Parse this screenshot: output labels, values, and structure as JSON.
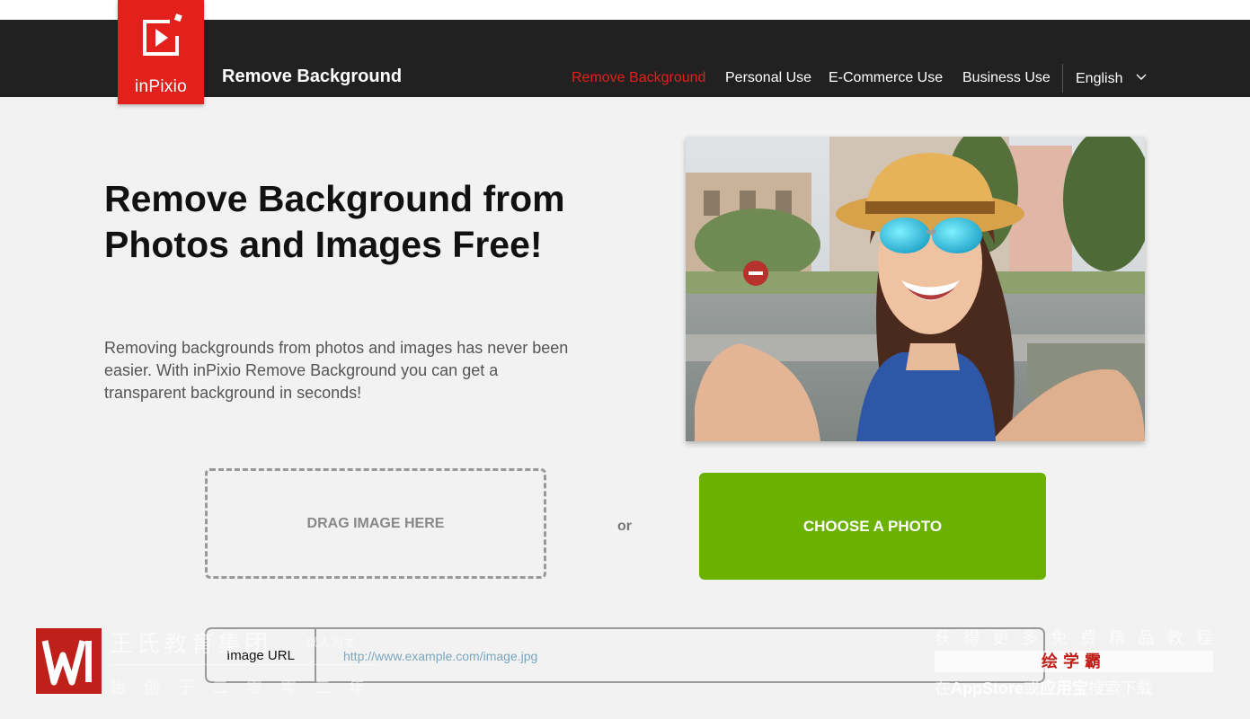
{
  "header": {
    "logo_text": "inPixio",
    "brand_title": "Remove Background",
    "nav": [
      {
        "label": "Remove Background",
        "active": true
      },
      {
        "label": "Personal Use",
        "active": false
      },
      {
        "label": "E-Commerce Use",
        "active": false
      },
      {
        "label": "Business Use",
        "active": false
      }
    ],
    "language": "English"
  },
  "hero": {
    "title": "Remove Background from Photos and Images Free!",
    "description": "Removing backgrounds from photos and images has never been easier. With inPixio Remove Background you can get a transparent background in seconds!"
  },
  "upload": {
    "drag_label": "DRAG IMAGE HERE",
    "or_label": "or",
    "choose_label": "CHOOSE A PHOTO",
    "url_label": "Image URL",
    "url_placeholder": "http://www.example.com/image.jpg"
  },
  "watermark": {
    "left_name": "王氏教育集团",
    "left_slogan": "以人为本",
    "left_year": "始创于二零零二年",
    "right_line1": "获得更多免费精品教程",
    "right_line2": "绘学霸",
    "right_line3_pre": "在",
    "right_line3_store": "AppStore",
    "right_line3_mid": "或",
    "right_line3_app": "应用宝",
    "right_line3_post": "搜索下载"
  },
  "colors": {
    "nav_bg": "#212121",
    "brand_red": "#e3201c",
    "cta_green": "#6ab100",
    "page_bg": "#f2f2f2"
  }
}
